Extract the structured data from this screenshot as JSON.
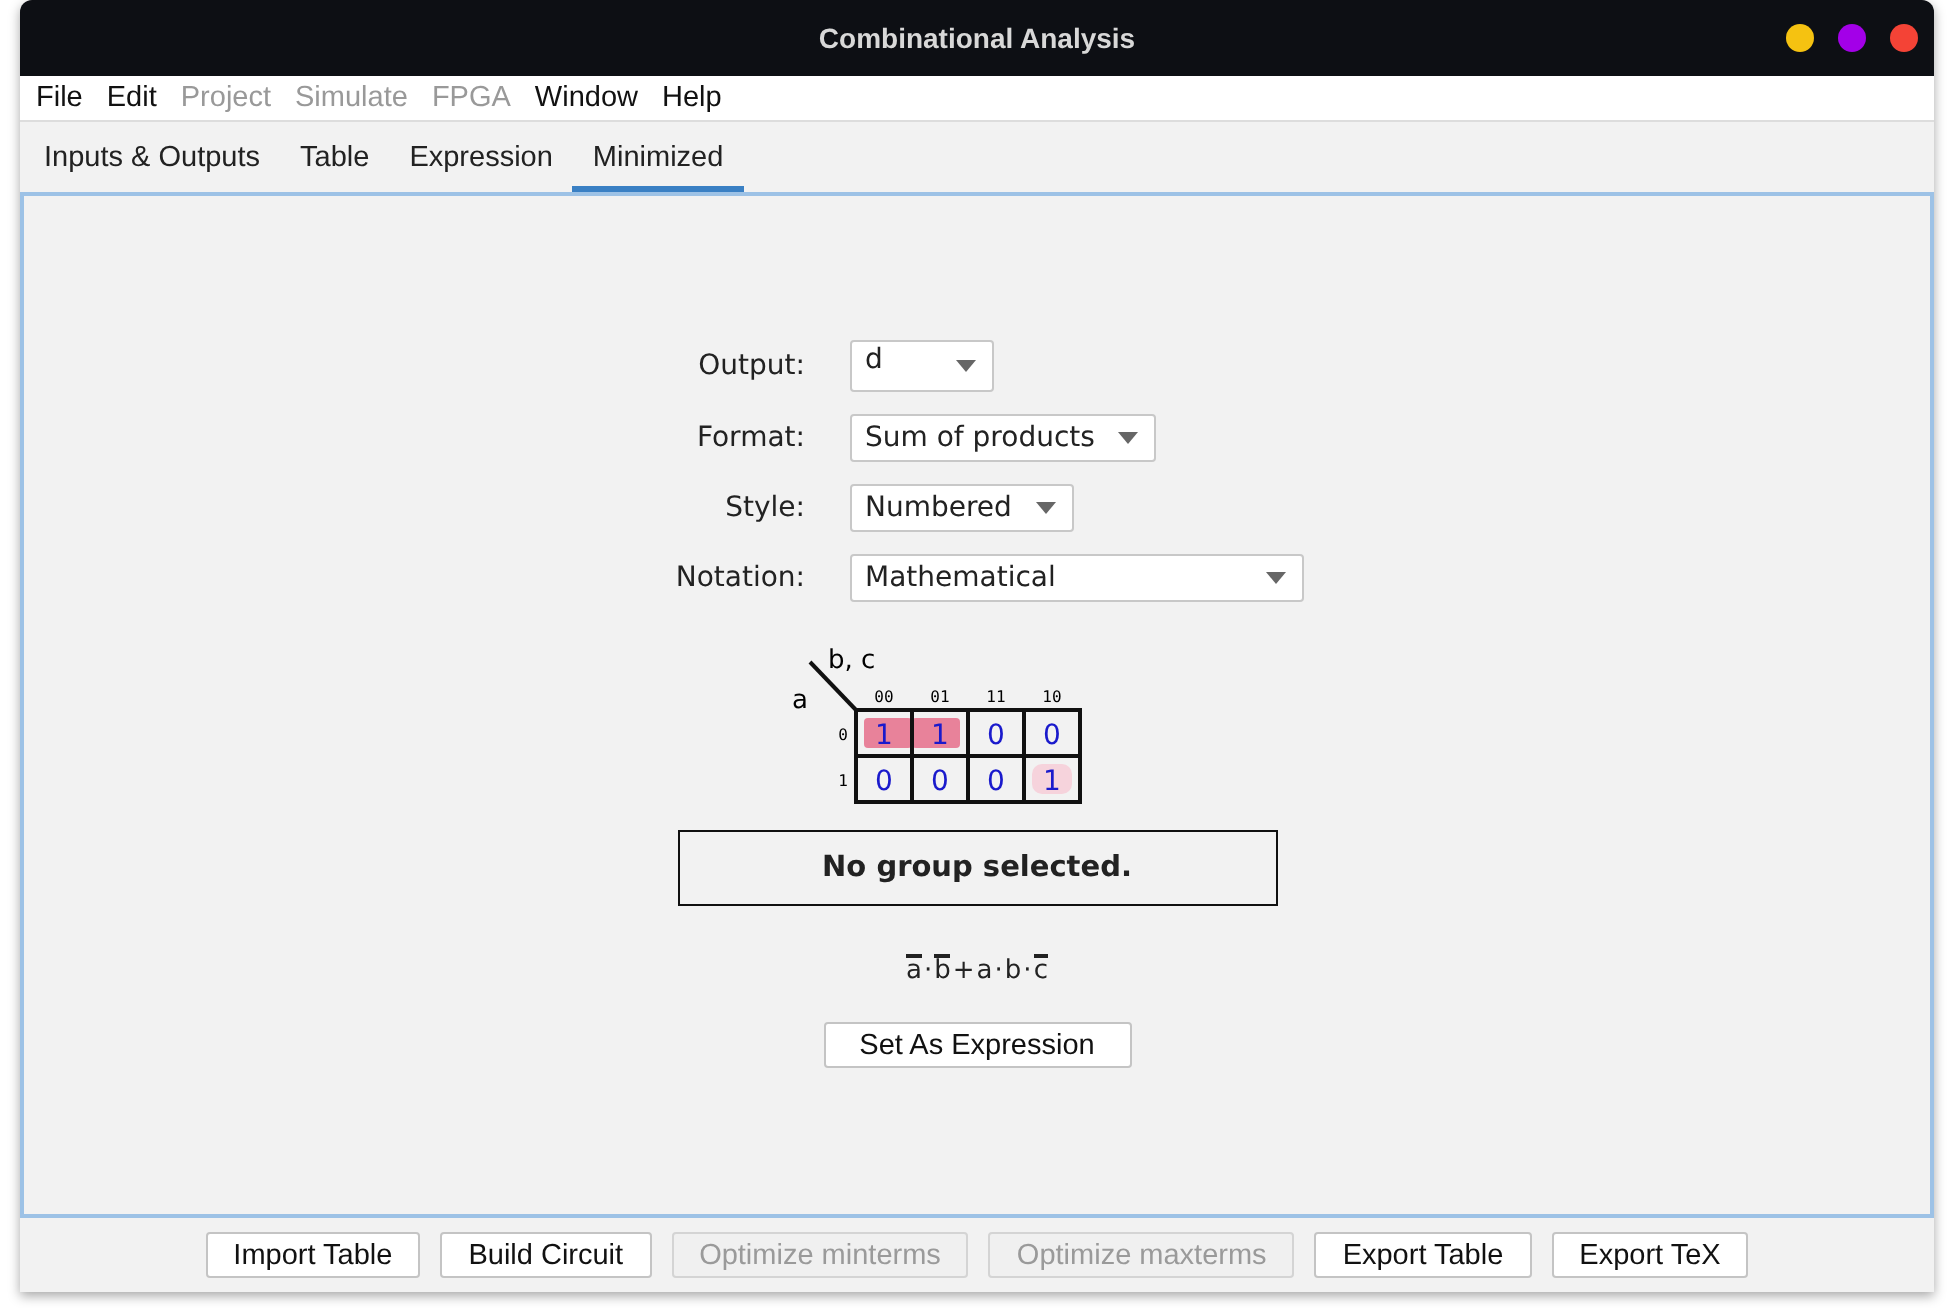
{
  "window": {
    "title": "Combinational Analysis",
    "controls": [
      {
        "color": "#f5c211"
      },
      {
        "color": "#a300e8"
      },
      {
        "color": "#f44336"
      }
    ]
  },
  "menu": [
    {
      "label": "File",
      "disabled": false
    },
    {
      "label": "Edit",
      "disabled": false
    },
    {
      "label": "Project",
      "disabled": true
    },
    {
      "label": "Simulate",
      "disabled": true
    },
    {
      "label": "FPGA",
      "disabled": true
    },
    {
      "label": "Window",
      "disabled": false
    },
    {
      "label": "Help",
      "disabled": false
    }
  ],
  "tabs": [
    {
      "label": "Inputs & Outputs",
      "selected": false
    },
    {
      "label": "Table",
      "selected": false
    },
    {
      "label": "Expression",
      "selected": false
    },
    {
      "label": "Minimized",
      "selected": true
    }
  ],
  "form": [
    {
      "label": "Output:",
      "value": "d"
    },
    {
      "label": "Format:",
      "value": "Sum of products"
    },
    {
      "label": "Style:",
      "value": "Numbered"
    },
    {
      "label": "Notation:",
      "value": "Mathematical"
    }
  ],
  "kmap": {
    "row_variable": "a",
    "column_variables": "b, c",
    "column_labels": [
      "00",
      "01",
      "11",
      "10"
    ],
    "rows": [
      {
        "label": "0",
        "cells": [
          {
            "value": "1",
            "color": "#e8829a"
          },
          {
            "value": "1",
            "color": "#e8829a"
          },
          {
            "value": "0"
          },
          {
            "value": "0"
          }
        ]
      },
      {
        "label": "1",
        "cells": [
          {
            "value": "0"
          },
          {
            "value": "0"
          },
          {
            "value": "0"
          },
          {
            "value": "1",
            "color": "#f6d3dc"
          }
        ]
      }
    ]
  },
  "group_info": "No group selected.",
  "expression": [
    {
      "kind": "var",
      "text": "a",
      "negated": true
    },
    {
      "kind": "op",
      "text": "·"
    },
    {
      "kind": "var",
      "text": "b",
      "negated": true
    },
    {
      "kind": "op",
      "text": "+"
    },
    {
      "kind": "var",
      "text": "a",
      "negated": false
    },
    {
      "kind": "op",
      "text": "·"
    },
    {
      "kind": "var",
      "text": "b",
      "negated": false
    },
    {
      "kind": "op",
      "text": "·"
    },
    {
      "kind": "var",
      "text": "c",
      "negated": true
    }
  ],
  "set_button": "Set As Expression",
  "buttons": [
    {
      "label": "Import Table",
      "disabled": false
    },
    {
      "label": "Build Circuit",
      "disabled": false
    },
    {
      "label": "Optimize minterms",
      "disabled": true
    },
    {
      "label": "Optimize maxterms",
      "disabled": true
    },
    {
      "label": "Export Table",
      "disabled": false
    },
    {
      "label": "Export TeX",
      "disabled": false
    }
  ]
}
